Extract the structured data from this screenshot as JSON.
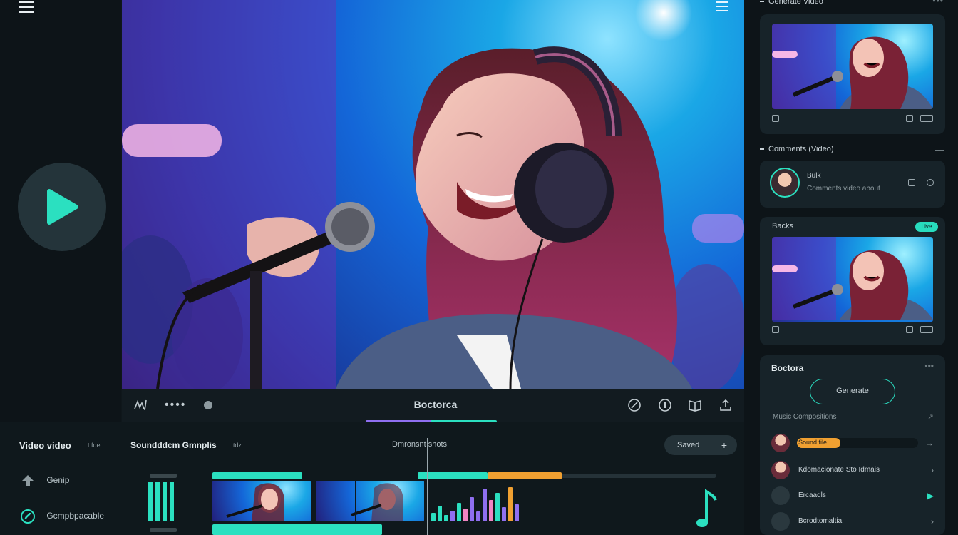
{
  "video": {
    "transport_title": "Bᴏctorca"
  },
  "right_panel": {
    "section1_title": "Generate Video",
    "section2_title": "Comments (Video)",
    "comment_name": "Bulk",
    "comment_text": "Comments video about",
    "card3_title": "Backs",
    "card3_badge": "Live",
    "settings_title": "Bᴏctora",
    "settings_button": "Generate",
    "settings_sub": "Music Compositions",
    "rows": [
      {
        "label": "Sound file",
        "fill_fraction": 0.36
      },
      {
        "label": "Kdomacionate Sto Idmais"
      },
      {
        "label": "Ercaadls"
      },
      {
        "label": "Bcrodtomaltia"
      }
    ]
  },
  "timeline": {
    "title": "Video video",
    "title_sub": "t:fde",
    "tracks_title": "Soundddcm Gmnplis",
    "tracks_sub": "tdz",
    "center_label": "Dmronsnt shots",
    "saved_label": "Saved",
    "left_items": [
      {
        "label": "Genip",
        "icon": "upload-arrow-icon"
      },
      {
        "label": "Gcmpbpacable",
        "icon": "music-note-icon"
      }
    ]
  },
  "colors": {
    "accent_teal": "#2be0c0",
    "accent_orange": "#f0a031",
    "accent_purple": "#8f6ff0",
    "panel_bg": "#172329"
  }
}
